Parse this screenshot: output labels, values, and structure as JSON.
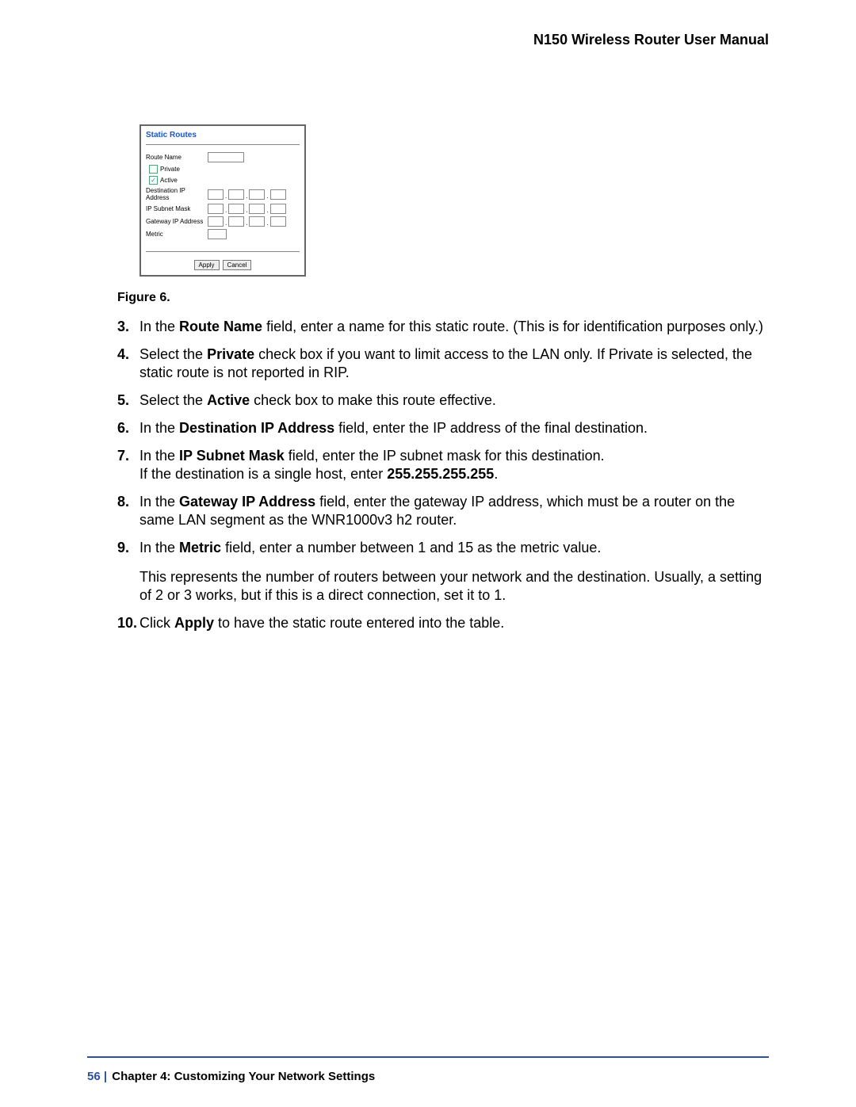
{
  "header": {
    "title": "N150 Wireless Router User Manual"
  },
  "figure": {
    "panel_title": "Static Routes",
    "labels": {
      "route_name": "Route Name",
      "private": "Private",
      "active": "Active",
      "dest_ip": "Destination IP Address",
      "subnet": "IP Subnet Mask",
      "gateway": "Gateway IP Address",
      "metric": "Metric"
    },
    "active_checked": "✓",
    "buttons": {
      "apply": "Apply",
      "cancel": "Cancel"
    },
    "caption": "Figure 6."
  },
  "steps": [
    {
      "n": "3.",
      "segs": [
        {
          "t": "In the "
        },
        {
          "t": "Route Name",
          "b": true
        },
        {
          "t": " field, enter a name for this static route. (This is for identification purposes only.)"
        }
      ]
    },
    {
      "n": "4.",
      "segs": [
        {
          "t": "Select the "
        },
        {
          "t": "Private",
          "b": true
        },
        {
          "t": " check box if you want to limit access to the LAN only. If Private is selected, the static route is not reported in RIP."
        }
      ]
    },
    {
      "n": "5.",
      "segs": [
        {
          "t": "Select the "
        },
        {
          "t": "Active",
          "b": true
        },
        {
          "t": " check box to make this route effective."
        }
      ]
    },
    {
      "n": "6.",
      "segs": [
        {
          "t": "In the "
        },
        {
          "t": "Destination IP Address",
          "b": true
        },
        {
          "t": " field, enter the IP address of the final destination."
        }
      ]
    },
    {
      "n": "7.",
      "segs": [
        {
          "t": "In the "
        },
        {
          "t": "IP Subnet Mask",
          "b": true
        },
        {
          "t": " field, enter the IP subnet mask for this destination."
        },
        {
          "br": true
        },
        {
          "t": "If the destination is a single host, enter "
        },
        {
          "t": "255.255.255.255",
          "b": true
        },
        {
          "t": "."
        }
      ]
    },
    {
      "n": "8.",
      "segs": [
        {
          "t": "In the "
        },
        {
          "t": "Gateway IP Address",
          "b": true
        },
        {
          "t": " field, enter the gateway IP address, which must be a router on the same LAN segment as the WNR1000v3 h2 router."
        }
      ]
    },
    {
      "n": "9.",
      "segs": [
        {
          "t": "In the "
        },
        {
          "t": "Metric",
          "b": true
        },
        {
          "t": " field, enter a number between 1 and 15 as the metric value."
        }
      ],
      "extra": [
        {
          "t": "This represents the number of routers between your network and the destination. Usually, a setting of 2 or 3 works, but if this is a direct connection, set it to 1."
        }
      ]
    },
    {
      "n": "10.",
      "segs": [
        {
          "t": "Click "
        },
        {
          "t": "Apply",
          "b": true
        },
        {
          "t": " to have the static route entered into the table."
        }
      ]
    }
  ],
  "footer": {
    "page": "56",
    "sep": "   |   ",
    "chapter": "Chapter 4:  Customizing Your Network Settings"
  }
}
